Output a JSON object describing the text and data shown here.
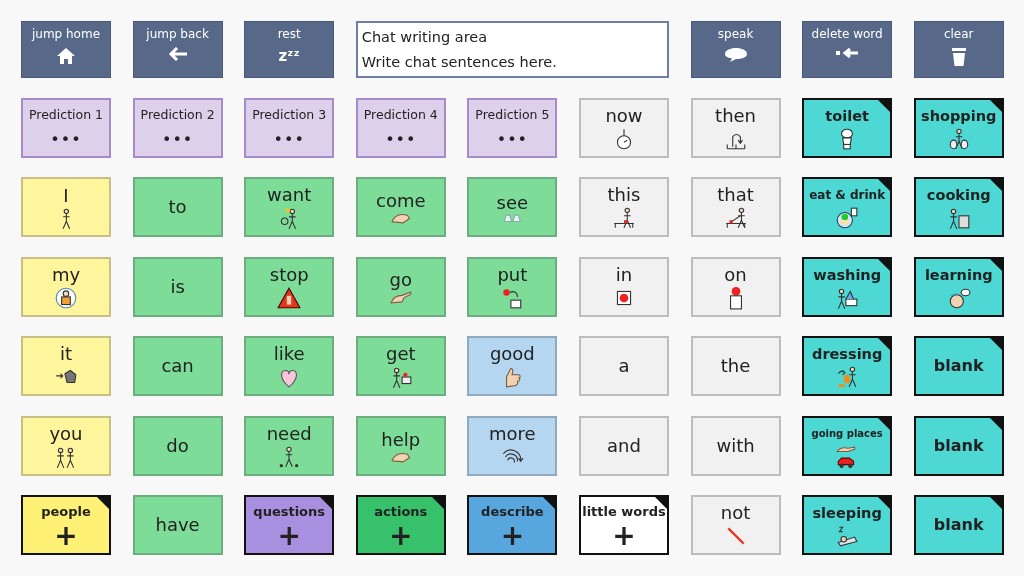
{
  "top_bar": {
    "left_buttons": [
      {
        "label": "jump home"
      },
      {
        "label": "jump back"
      },
      {
        "label": "rest",
        "glyph": "zᶻᶻ"
      }
    ],
    "chat": {
      "lines": [
        "Chat writing area",
        "Write chat sentences here."
      ]
    },
    "right_buttons": [
      {
        "label": "speak"
      },
      {
        "label": "delete word"
      },
      {
        "label": "clear"
      }
    ]
  },
  "grid": [
    [
      {
        "label": "Prediction 1",
        "kind": "prediction",
        "dots": "•••",
        "color": "#ddd0ea"
      },
      {
        "label": "Prediction 2",
        "kind": "prediction",
        "dots": "•••",
        "color": "#ddd0ea"
      },
      {
        "label": "Prediction 3",
        "kind": "prediction",
        "dots": "•••",
        "color": "#ddd0ea"
      },
      {
        "label": "Prediction 4",
        "kind": "prediction",
        "dots": "•••",
        "color": "#ddd0ea"
      },
      {
        "label": "Prediction 5",
        "kind": "prediction",
        "dots": "•••",
        "color": "#ddd0ea"
      },
      {
        "label": "now",
        "kind": "word",
        "color": "#f1f1f1"
      },
      {
        "label": "then",
        "kind": "word",
        "color": "#f1f1f1"
      },
      {
        "label": "toilet",
        "kind": "folder",
        "color": "#4dd8d3"
      },
      {
        "label": "shopping",
        "kind": "folder",
        "color": "#4dd8d3"
      }
    ],
    [
      {
        "label": "I",
        "kind": "word",
        "color": "#fff59d"
      },
      {
        "label": "to",
        "kind": "word",
        "color": "#7ddc98"
      },
      {
        "label": "want",
        "kind": "word",
        "color": "#7ddc98"
      },
      {
        "label": "come",
        "kind": "word",
        "color": "#7ddc98"
      },
      {
        "label": "see",
        "kind": "word",
        "color": "#7ddc98"
      },
      {
        "label": "this",
        "kind": "word",
        "color": "#f1f1f1"
      },
      {
        "label": "that",
        "kind": "word",
        "color": "#f1f1f1"
      },
      {
        "label": "eat & drink",
        "kind": "folder",
        "color": "#4dd8d3"
      },
      {
        "label": "cooking",
        "kind": "folder",
        "color": "#4dd8d3"
      }
    ],
    [
      {
        "label": "my",
        "kind": "word",
        "color": "#fff59d"
      },
      {
        "label": "is",
        "kind": "word",
        "color": "#7ddc98"
      },
      {
        "label": "stop",
        "kind": "word",
        "color": "#7ddc98"
      },
      {
        "label": "go",
        "kind": "word",
        "color": "#7ddc98"
      },
      {
        "label": "put",
        "kind": "word",
        "color": "#7ddc98"
      },
      {
        "label": "in",
        "kind": "word",
        "color": "#f1f1f1"
      },
      {
        "label": "on",
        "kind": "word",
        "color": "#f1f1f1"
      },
      {
        "label": "washing",
        "kind": "folder",
        "color": "#4dd8d3"
      },
      {
        "label": "learning",
        "kind": "folder",
        "color": "#4dd8d3"
      }
    ],
    [
      {
        "label": "it",
        "kind": "word",
        "color": "#fff59d"
      },
      {
        "label": "can",
        "kind": "word",
        "color": "#7ddc98"
      },
      {
        "label": "like",
        "kind": "word",
        "color": "#7ddc98"
      },
      {
        "label": "get",
        "kind": "word",
        "color": "#7ddc98"
      },
      {
        "label": "good",
        "kind": "word",
        "color": "#b5d6f0"
      },
      {
        "label": "a",
        "kind": "word",
        "color": "#f1f1f1"
      },
      {
        "label": "the",
        "kind": "word",
        "color": "#f1f1f1"
      },
      {
        "label": "dressing",
        "kind": "folder",
        "color": "#4dd8d3"
      },
      {
        "label": "blank",
        "kind": "folder",
        "color": "#4dd8d3"
      }
    ],
    [
      {
        "label": "you",
        "kind": "word",
        "color": "#fff59d"
      },
      {
        "label": "do",
        "kind": "word",
        "color": "#7ddc98"
      },
      {
        "label": "need",
        "kind": "word",
        "color": "#7ddc98"
      },
      {
        "label": "help",
        "kind": "word",
        "color": "#7ddc98"
      },
      {
        "label": "more",
        "kind": "word",
        "color": "#b5d6f0"
      },
      {
        "label": "and",
        "kind": "word",
        "color": "#f1f1f1"
      },
      {
        "label": "with",
        "kind": "word",
        "color": "#f1f1f1"
      },
      {
        "label": "going places",
        "kind": "folder",
        "color": "#4dd8d3"
      },
      {
        "label": "blank",
        "kind": "folder",
        "color": "#4dd8d3"
      }
    ],
    [
      {
        "label": "people",
        "kind": "category",
        "plus": "+",
        "color": "#fff176"
      },
      {
        "label": "have",
        "kind": "word",
        "color": "#7ddc98"
      },
      {
        "label": "questions",
        "kind": "category",
        "plus": "+",
        "color": "#a88fdf"
      },
      {
        "label": "actions",
        "kind": "category",
        "plus": "+",
        "color": "#37c16b"
      },
      {
        "label": "describe",
        "kind": "category",
        "plus": "+",
        "color": "#58a6de"
      },
      {
        "label": "little words",
        "kind": "category",
        "plus": "+",
        "color": "#ffffff"
      },
      {
        "label": "not",
        "kind": "word",
        "color": "#f1f1f1"
      },
      {
        "label": "sleeping",
        "kind": "folder",
        "color": "#4dd8d3"
      },
      {
        "label": "blank",
        "kind": "folder",
        "color": "#4dd8d3"
      }
    ]
  ]
}
